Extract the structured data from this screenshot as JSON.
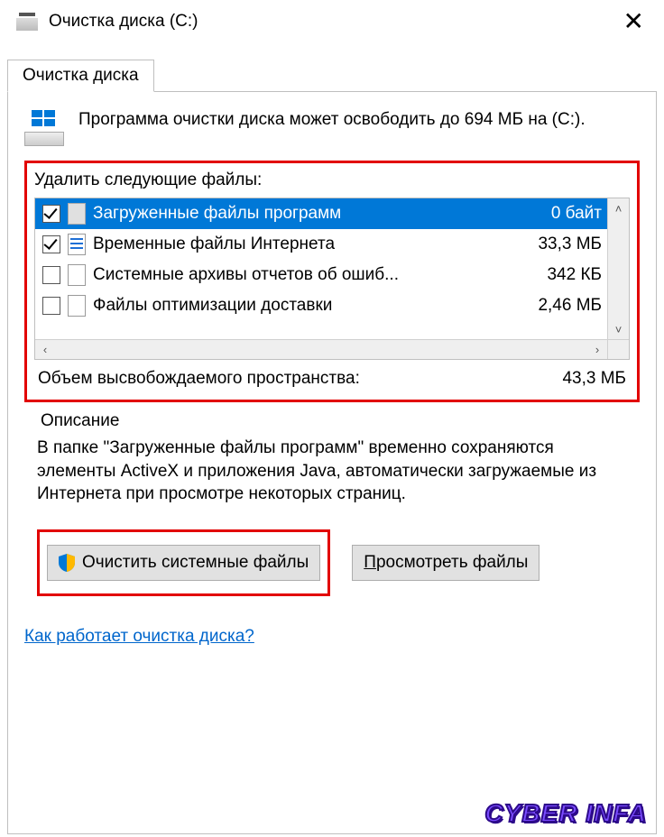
{
  "window": {
    "title": "Очистка диска  (C:)"
  },
  "tab": {
    "label": "Очистка диска"
  },
  "summary": {
    "text": "Программа очистки диска может освободить до 694 МБ на  (C:)."
  },
  "files": {
    "group_label": "Удалить следующие файлы:",
    "items": [
      {
        "checked": true,
        "icon": "blank",
        "label": "Загруженные файлы программ",
        "size": "0 байт",
        "selected": true
      },
      {
        "checked": true,
        "icon": "lines",
        "label": "Временные файлы Интернета",
        "size": "33,3 МБ",
        "selected": false
      },
      {
        "checked": false,
        "icon": "plain",
        "label": "Системные архивы отчетов об ошиб...",
        "size": "342 КБ",
        "selected": false
      },
      {
        "checked": false,
        "icon": "plain",
        "label": "Файлы оптимизации доставки",
        "size": "2,46 МБ",
        "selected": false
      }
    ],
    "total_label": "Объем высвобождаемого пространства:",
    "total_value": "43,3 МБ"
  },
  "description": {
    "legend": "Описание",
    "text": "В папке \"Загруженные файлы программ\" временно сохраняются элементы ActiveX и приложения Java, автоматически загружаемые из Интернета при просмотре некоторых страниц."
  },
  "buttons": {
    "clean_system": "Очистить системные файлы",
    "view_files_prefix": "П",
    "view_files_rest": "росмотреть файлы"
  },
  "help_link": "Как работает очистка диска?",
  "watermark": "CYBER INFA"
}
